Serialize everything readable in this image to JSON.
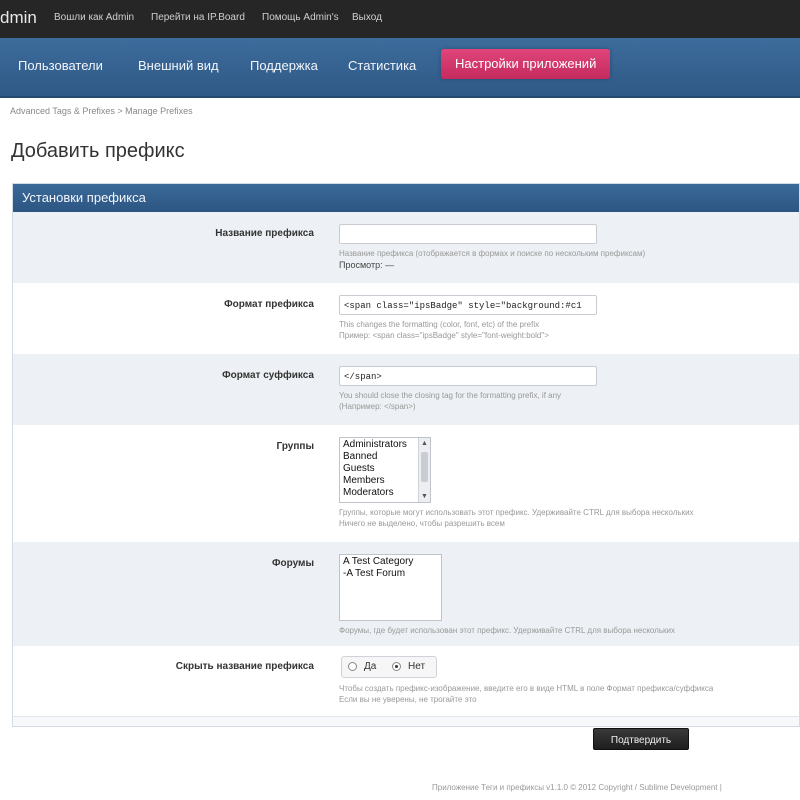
{
  "topbar": {
    "brand": "dmin",
    "links": [
      "Вошли как Admin",
      "Перейти на IP.Board",
      "Помощь Admin's",
      "Выход"
    ]
  },
  "nav": {
    "items": [
      "Пользователи",
      "Внешний вид",
      "Поддержка",
      "Статистика",
      "Настройки приложений"
    ]
  },
  "breadcrumb": "Advanced Tags & Prefixes  >  Manage Prefixes",
  "page_title": "Добавить префикс",
  "panel": {
    "title": "Установки префикса",
    "prefix_name": {
      "label": "Название префикса",
      "value": "",
      "hint": "Название префикса (отображается в формах и поиске по нескольким префиксам)",
      "preview_label": "Просмотр: —"
    },
    "prefix_format": {
      "label": "Формат префикса",
      "value": "<span class=\"ipsBadge\" style=\"background:#c1",
      "hint1": "This changes the formatting (color, font, etc) of the prefix",
      "hint2": "Пример: <span class=\"ipsBadge\" style=\"font-weight:bold\">"
    },
    "suffix_format": {
      "label": "Формат суффикса",
      "value": "</span>",
      "hint1": "You should close the closing tag for the formatting prefix, if any",
      "hint2": "(Например: </span>)"
    },
    "groups": {
      "label": "Группы",
      "options": [
        "Administrators",
        "Banned",
        "Guests",
        "Members",
        "Moderators"
      ],
      "hint1": "Группы, которые могут использовать этот префикс. Удерживайте CTRL для выбора нескольких",
      "hint2": "Ничего не выделено, чтобы разрешить всем"
    },
    "forums": {
      "label": "Форумы",
      "options": [
        "A Test Category",
        "-A Test Forum"
      ],
      "hint": "Форумы, где будет использован этот префикс. Удерживайте CTRL для выбора нескольких"
    },
    "hide_name": {
      "label": "Скрыть название префикса",
      "yes": "Да",
      "no": "Нет",
      "selected": "Нет",
      "hint1": "Чтобы создать префикс-изображение, введите его в виде HTML в поле Формат префикса/суффикса",
      "hint2": "Если вы не уверены, не трогайте это"
    },
    "submit_label": "Подтвердить"
  },
  "footer": "Приложение Теги и префиксы v1.1.0 © 2012 Copyright / Sublime Development  |"
}
